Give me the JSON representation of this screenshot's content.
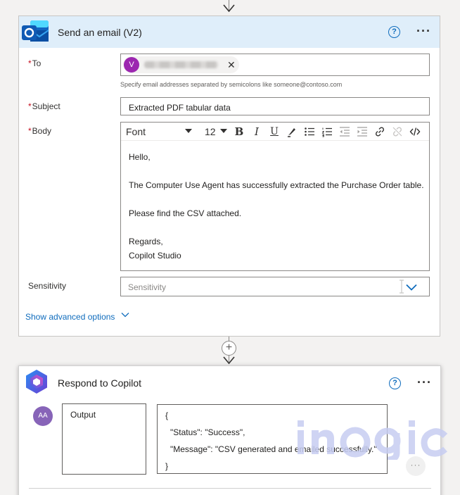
{
  "send_email": {
    "title": "Send an email (V2)",
    "help_icon": "?",
    "more_icon": "···",
    "to": {
      "label": "To",
      "required_marker": "*",
      "chip_initial": "V",
      "remove_icon": "✕",
      "helper": "Specify email addresses separated by semicolons like someone@contoso.com"
    },
    "subject": {
      "label": "Subject",
      "required_marker": "*",
      "value": "Extracted PDF tabular data"
    },
    "body": {
      "label": "Body",
      "required_marker": "*",
      "toolbar": {
        "font": "Font",
        "size": "12",
        "bold": "B",
        "italic": "I",
        "underline": "U"
      },
      "lines": [
        "Hello,",
        "The Computer Use Agent has successfully extracted the Purchase Order table.",
        "Please find the CSV attached.",
        "Regards,",
        "Copilot Studio"
      ]
    },
    "sensitivity": {
      "label": "Sensitivity",
      "placeholder": "Sensitivity"
    },
    "advanced_link": "Show advanced options"
  },
  "add_step": "+",
  "respond": {
    "title": "Respond to Copilot",
    "help_icon": "?",
    "more_icon": "···",
    "avatar_initials": "AA",
    "output_label": "Output",
    "json_lines": [
      "{",
      "\"Status\": \"Success\",",
      "\"Message\": \"CSV generated and emailed successfully.\"",
      "}"
    ],
    "overflow_dots": "···"
  },
  "colors": {
    "header_bg": "#dfeefa",
    "accent": "#0f6cbd",
    "required": "#c50f1f",
    "chip_avatar": "#9c27b0",
    "aa_avatar": "#8764b8"
  }
}
